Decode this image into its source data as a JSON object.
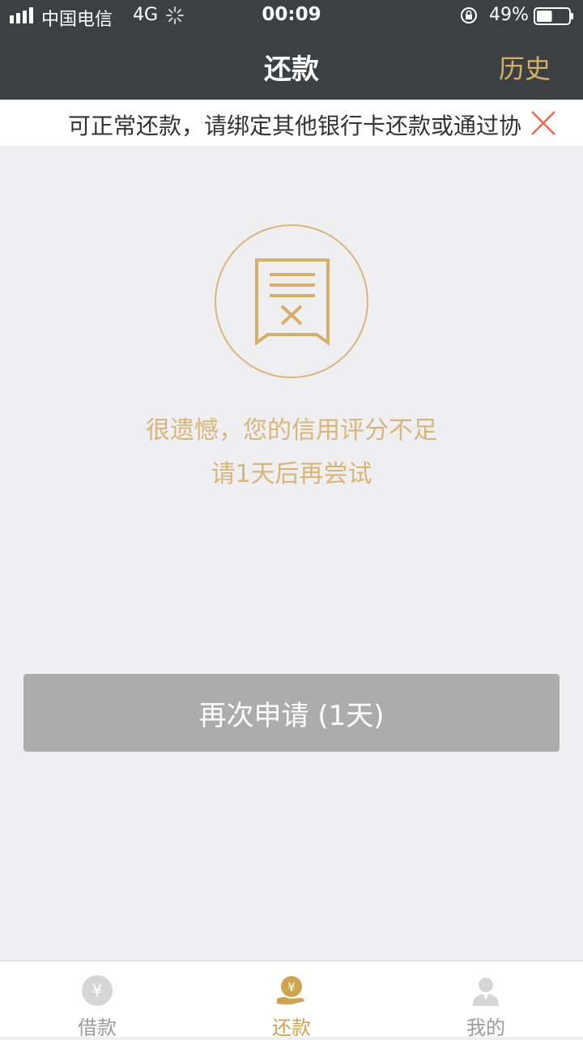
{
  "status_bar": {
    "carrier": "中国电信",
    "network": "4G",
    "time": "00:09",
    "battery_percent": "49%",
    "battery_level": 0.49
  },
  "nav": {
    "title": "还款",
    "history_label": "历史"
  },
  "notice": {
    "text": "可正常还款，请绑定其他银行卡还款或通过协议"
  },
  "empty_state": {
    "line1": "很遗憾，您的信用评分不足",
    "line2": "请1天后再尝试"
  },
  "retry_button": {
    "label": "再次申请 (1天)"
  },
  "tabbar": {
    "items": [
      {
        "label": "借款",
        "icon": "yuan-coin-icon",
        "active": false
      },
      {
        "label": "还款",
        "icon": "repay-hand-icon",
        "active": true
      },
      {
        "label": "我的",
        "icon": "person-icon",
        "active": false
      }
    ]
  },
  "colors": {
    "header_bg": "#3d4043",
    "accent_gold": "#d4b06a",
    "close_red": "#e9694d",
    "button_disabled": "#acacac",
    "page_bg": "#efeff1"
  }
}
